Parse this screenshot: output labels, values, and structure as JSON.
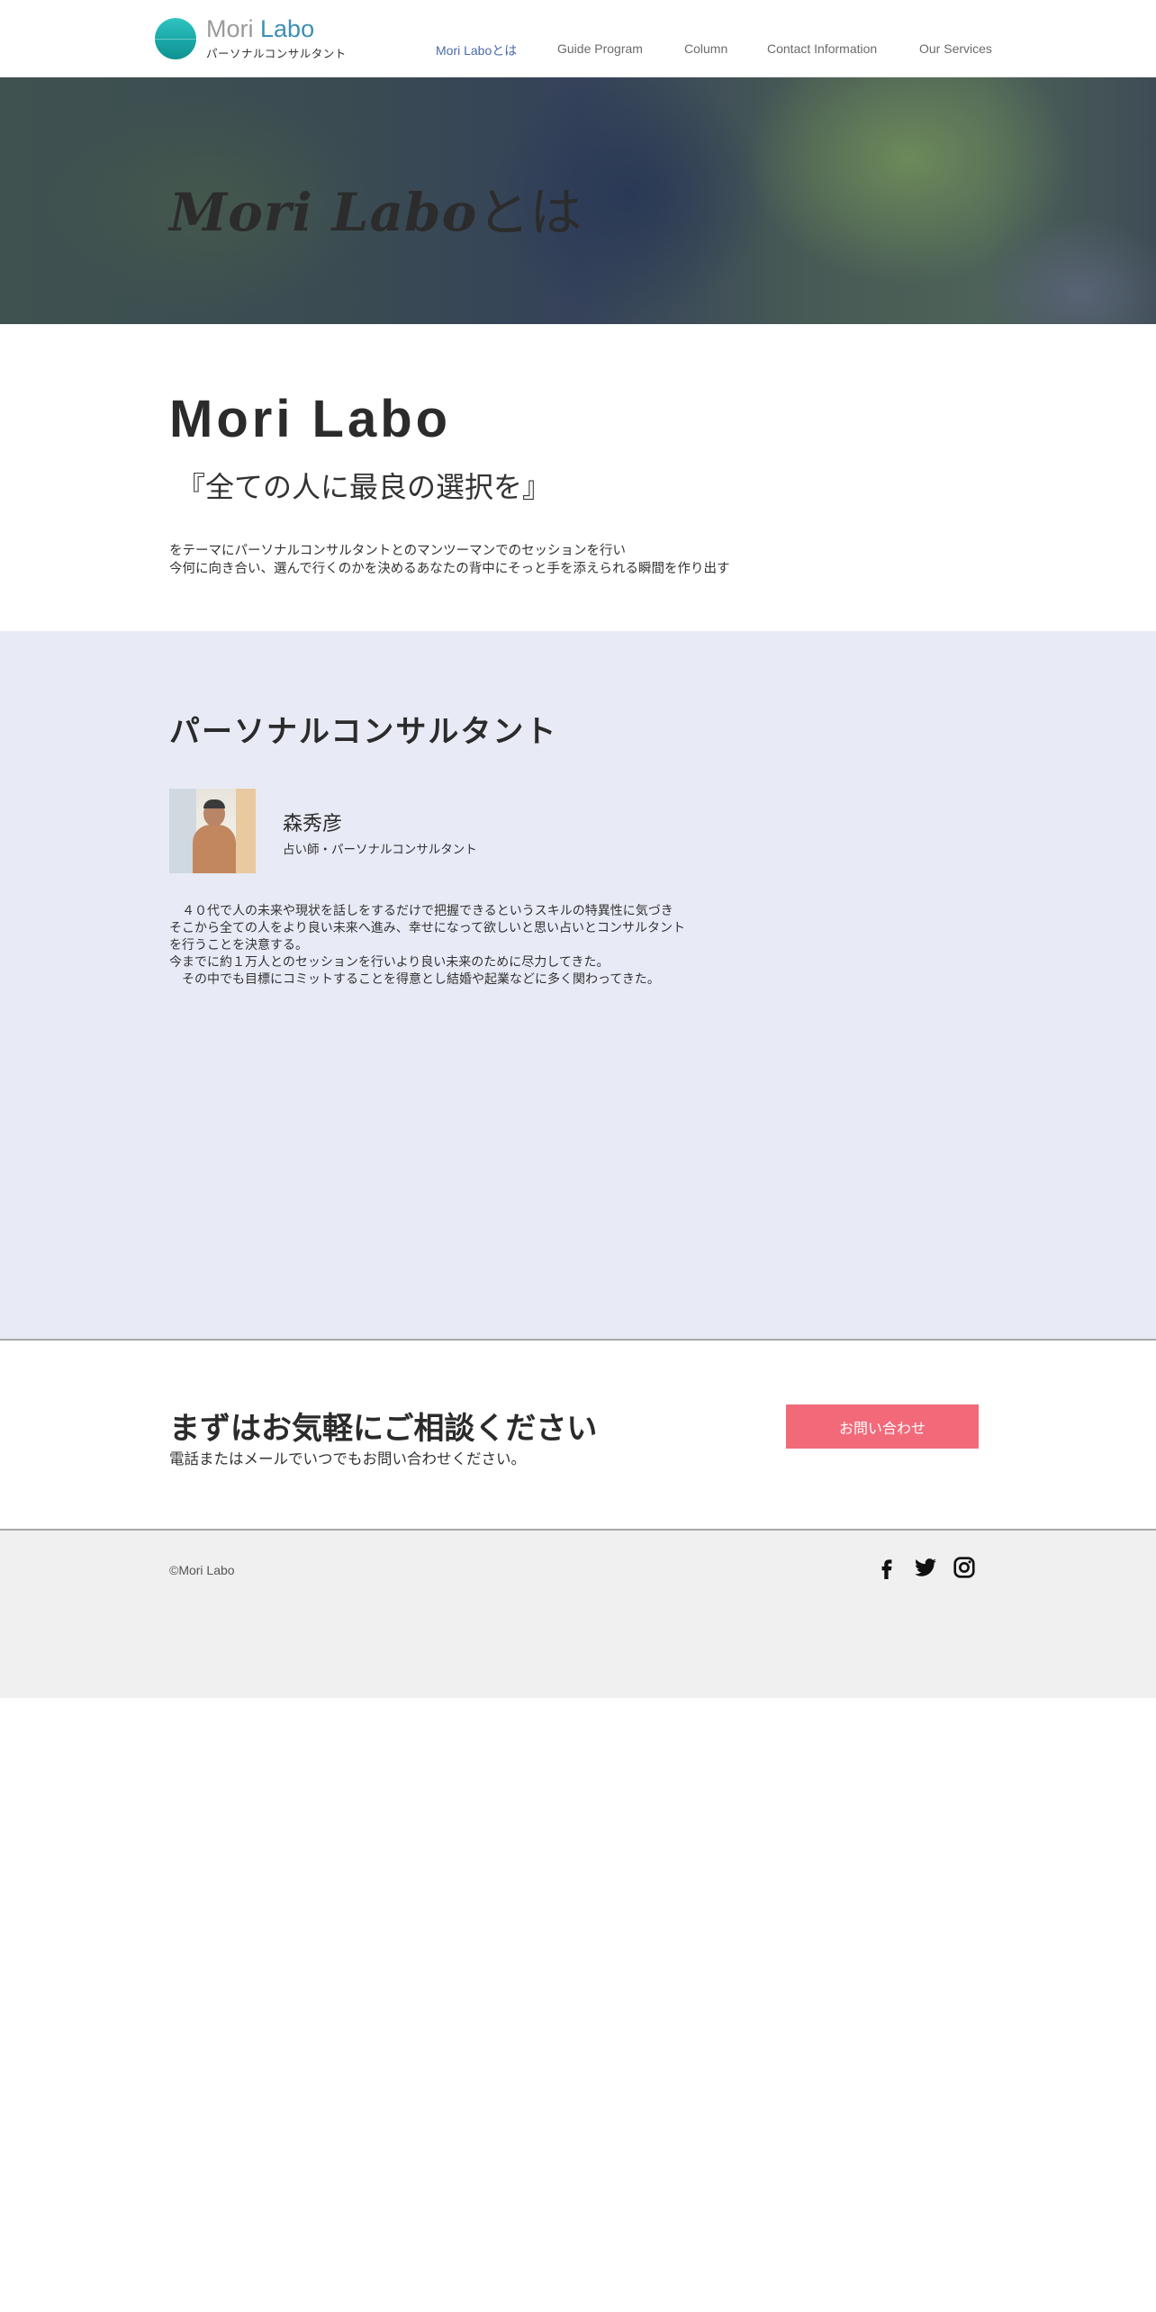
{
  "header": {
    "logo_mori": "Mori",
    "logo_labo": "Labo",
    "logo_sub": "パーソナルコンサルタント",
    "nav": [
      {
        "label": "Mori Laboとは",
        "active": true
      },
      {
        "label": "Guide Program",
        "active": false
      },
      {
        "label": "Column",
        "active": false
      },
      {
        "label": "Contact Information",
        "active": false
      },
      {
        "label": "Our Services",
        "active": false
      }
    ]
  },
  "hero": {
    "title_script": "Mori Labo",
    "title_suffix": "とは"
  },
  "about": {
    "heading": "Mori Labo",
    "tagline": "『全ての人に最良の選択を』",
    "body_line1": "をテーマにパーソナルコンサルタントとのマンツーマンでのセッションを行い",
    "body_line2": "今何に向き合い、選んで行くのかを決めるあなたの背中にそっと手を添えられる瞬間を作り出す"
  },
  "consultant": {
    "section_title": "パーソナルコンサルタント",
    "name": "森秀彦",
    "role": "占い師・パーソナルコンサルタント",
    "bio": "　４０代で人の未来や現状を話しをするだけで把握できるというスキルの特異性に気づき\nそこから全ての人をより良い未来へ進み、幸せになって欲しいと思い占いとコンサルタント\nを行うことを決意する。\n今までに約１万人とのセッションを行いより良い未来のために尽力してきた。\n　その中でも目標にコミットすることを得意とし結婚や起業などに多く関わってきた。"
  },
  "cta": {
    "title": "まずはお気軽にご相談ください",
    "subtitle": "電話またはメールでいつでもお問い合わせください。",
    "button_label": "お問い合わせ",
    "button_color": "#f26a7a"
  },
  "footer": {
    "copyright": "©Mori Labo",
    "social_icons": [
      "facebook-icon",
      "twitter-icon",
      "instagram-icon"
    ]
  },
  "colors": {
    "accent": "#3e8fb3",
    "nav_active": "#4a6aa8",
    "consult_bg": "#e8ebf6",
    "footer_bg": "#f0f0f0"
  }
}
